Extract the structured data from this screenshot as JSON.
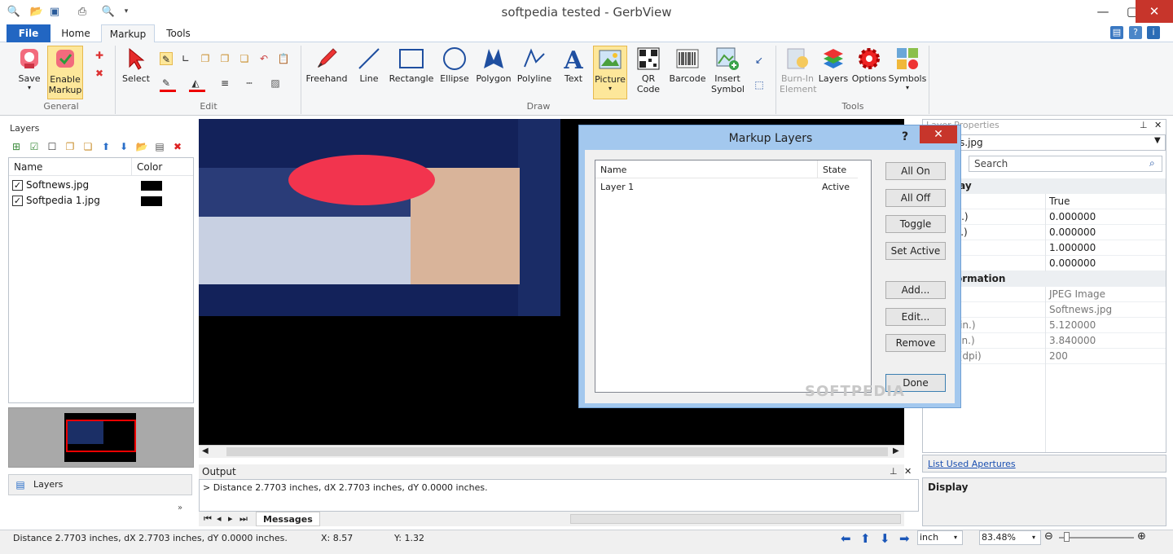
{
  "window": {
    "title": "softpedia tested - GerbView"
  },
  "ribbon_tabs": [
    "File",
    "Home",
    "Markup",
    "Tools"
  ],
  "ribbon": {
    "groups": {
      "general": "General",
      "edit": "Edit",
      "draw": "Draw",
      "tools": "Tools"
    },
    "buttons": {
      "save": "Save",
      "enable_markup": "Enable Markup",
      "select": "Select",
      "freehand": "Freehand",
      "line": "Line",
      "rectangle": "Rectangle",
      "ellipse": "Ellipse",
      "polygon": "Polygon",
      "polyline": "Polyline",
      "text": "Text",
      "picture": "Picture",
      "qr_code": "QR Code",
      "barcode": "Barcode",
      "insert_symbol": "Insert Symbol",
      "burn_in": "Burn-In Element",
      "layers": "Layers",
      "options": "Options",
      "symbols": "Symbols"
    }
  },
  "layers_panel": {
    "title": "Layers",
    "columns": [
      "Name",
      "Color"
    ],
    "rows": [
      {
        "name": "Softnews.jpg",
        "color": "#000000"
      },
      {
        "name": "Softpedia 1.jpg",
        "color": "#000000"
      }
    ],
    "bottom_tab": "Layers"
  },
  "output": {
    "title": "Output",
    "text": "> Distance 2.7703 inches, dX 2.7703 inches, dY 0.0000 inches.",
    "tab": "Messages"
  },
  "properties": {
    "title": "Layer Properties",
    "selector": "s.jpg",
    "search_placeholder": "Search",
    "category_display": "lay",
    "category_info": "ormation",
    "rows": [
      {
        "k": "le",
        "v": "True"
      },
      {
        "k": "rt X (in.)",
        "v": "0.000000"
      },
      {
        "k": "rt Y (in.)",
        "v": "0.000000"
      },
      {
        "k": "e",
        "v": "1.000000"
      },
      {
        "k": "ation",
        "v": "0.000000"
      }
    ],
    "info_rows": [
      {
        "k": "ormat",
        "v": "JPEG Image"
      },
      {
        "k": "ame",
        "v": "Softnews.jpg"
      },
      {
        "k": "nts X (in.)",
        "v": "5.120000"
      },
      {
        "k": "nts Y (in.)",
        "v": "3.840000"
      },
      {
        "k": "lution (dpi)",
        "v": "200"
      }
    ],
    "link": "List Used Apertures",
    "footer_title": "Display"
  },
  "status": {
    "distance": "Distance 2.7703 inches, dX 2.7703 inches, dY 0.0000 inches.",
    "x": "X: 8.57",
    "y": "Y: 1.32",
    "unit": "inch",
    "zoom": "83.48%"
  },
  "dialog": {
    "title": "Markup Layers",
    "columns": [
      "Name",
      "State"
    ],
    "rows": [
      {
        "name": "Layer 1",
        "state": "Active"
      }
    ],
    "buttons": {
      "all_on": "All On",
      "all_off": "All Off",
      "toggle": "Toggle",
      "set_active": "Set Active",
      "add": "Add...",
      "edit": "Edit...",
      "remove": "Remove",
      "done": "Done"
    },
    "watermark": "SOFTPEDIA"
  },
  "colors": {
    "accent": "#2266c2",
    "highlight": "#fde79a",
    "close": "#c7352b",
    "dialog_frame": "#a3c8ee"
  }
}
